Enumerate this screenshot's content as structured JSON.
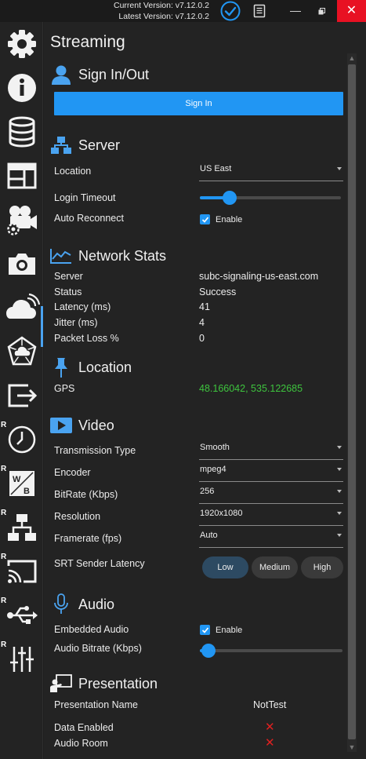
{
  "titlebar": {
    "current_version": "Current Version: v7.12.0.2",
    "latest_version": "Latest Version: v7.12.0.2",
    "close_glyph": "✕",
    "minimize_glyph": "—"
  },
  "sidebar": {
    "items": [
      {
        "name": "settings-gear-icon"
      },
      {
        "name": "info-icon"
      },
      {
        "name": "database-icon"
      },
      {
        "name": "layout-icon"
      },
      {
        "name": "camera-settings-icon"
      },
      {
        "name": "camera-icon"
      },
      {
        "name": "cloud-streaming-icon",
        "active": true
      },
      {
        "name": "network-cloud-icon"
      },
      {
        "name": "export-icon"
      },
      {
        "name": "clock-icon",
        "badge": "R"
      },
      {
        "name": "white-balance-icon",
        "badge": "R"
      },
      {
        "name": "network-icon",
        "badge": "R"
      },
      {
        "name": "cast-icon",
        "badge": "R"
      },
      {
        "name": "usb-icon",
        "badge": "R"
      },
      {
        "name": "mixer-sliders-icon",
        "badge": "R"
      }
    ],
    "wb_letters": {
      "w": "W",
      "b": "B"
    }
  },
  "page": {
    "title": "Streaming"
  },
  "signin": {
    "heading": "Sign In/Out",
    "button": "Sign In"
  },
  "server": {
    "heading": "Server",
    "location_label": "Location",
    "location_value": "US East",
    "login_timeout_label": "Login Timeout",
    "login_timeout_level": 0.2,
    "auto_reconnect_label": "Auto Reconnect",
    "enable_label": "Enable"
  },
  "network_stats": {
    "heading": "Network Stats",
    "rows": [
      {
        "label": "Server",
        "value": "subc-signaling-us-east.com"
      },
      {
        "label": "Status",
        "value": "Success"
      },
      {
        "label": "Latency (ms)",
        "value": "41"
      },
      {
        "label": "Jitter (ms)",
        "value": "4"
      },
      {
        "label": "Packet Loss %",
        "value": "0"
      }
    ]
  },
  "location": {
    "heading": "Location",
    "gps_label": "GPS",
    "gps_value": "48.166042, 535.122685"
  },
  "video": {
    "heading": "Video",
    "transmission_type_label": "Transmission Type",
    "transmission_type_value": "Smooth",
    "encoder_label": "Encoder",
    "encoder_value": "mpeg4",
    "bitrate_label": "BitRate (Kbps)",
    "bitrate_value": "256",
    "resolution_label": "Resolution",
    "resolution_value": "1920x1080",
    "framerate_label": "Framerate (fps)",
    "framerate_value": "Auto",
    "srt_label": "SRT Sender Latency",
    "srt_options": [
      "Low",
      "Medium",
      "High"
    ],
    "srt_selected": "Low"
  },
  "audio": {
    "heading": "Audio",
    "embedded_label": "Embedded Audio",
    "enable_label": "Enable",
    "bitrate_label": "Audio Bitrate (Kbps)",
    "bitrate_level": 0.0
  },
  "presentation": {
    "heading": "Presentation",
    "name_label": "Presentation Name",
    "name_value": "NotTest",
    "data_enabled_label": "Data Enabled",
    "audio_room_label": "Audio Room",
    "x_glyph": "✕"
  },
  "colors": {
    "accent": "#2196f3",
    "close_red": "#e81123",
    "green": "#3ec43e",
    "error_red": "#e02020"
  }
}
